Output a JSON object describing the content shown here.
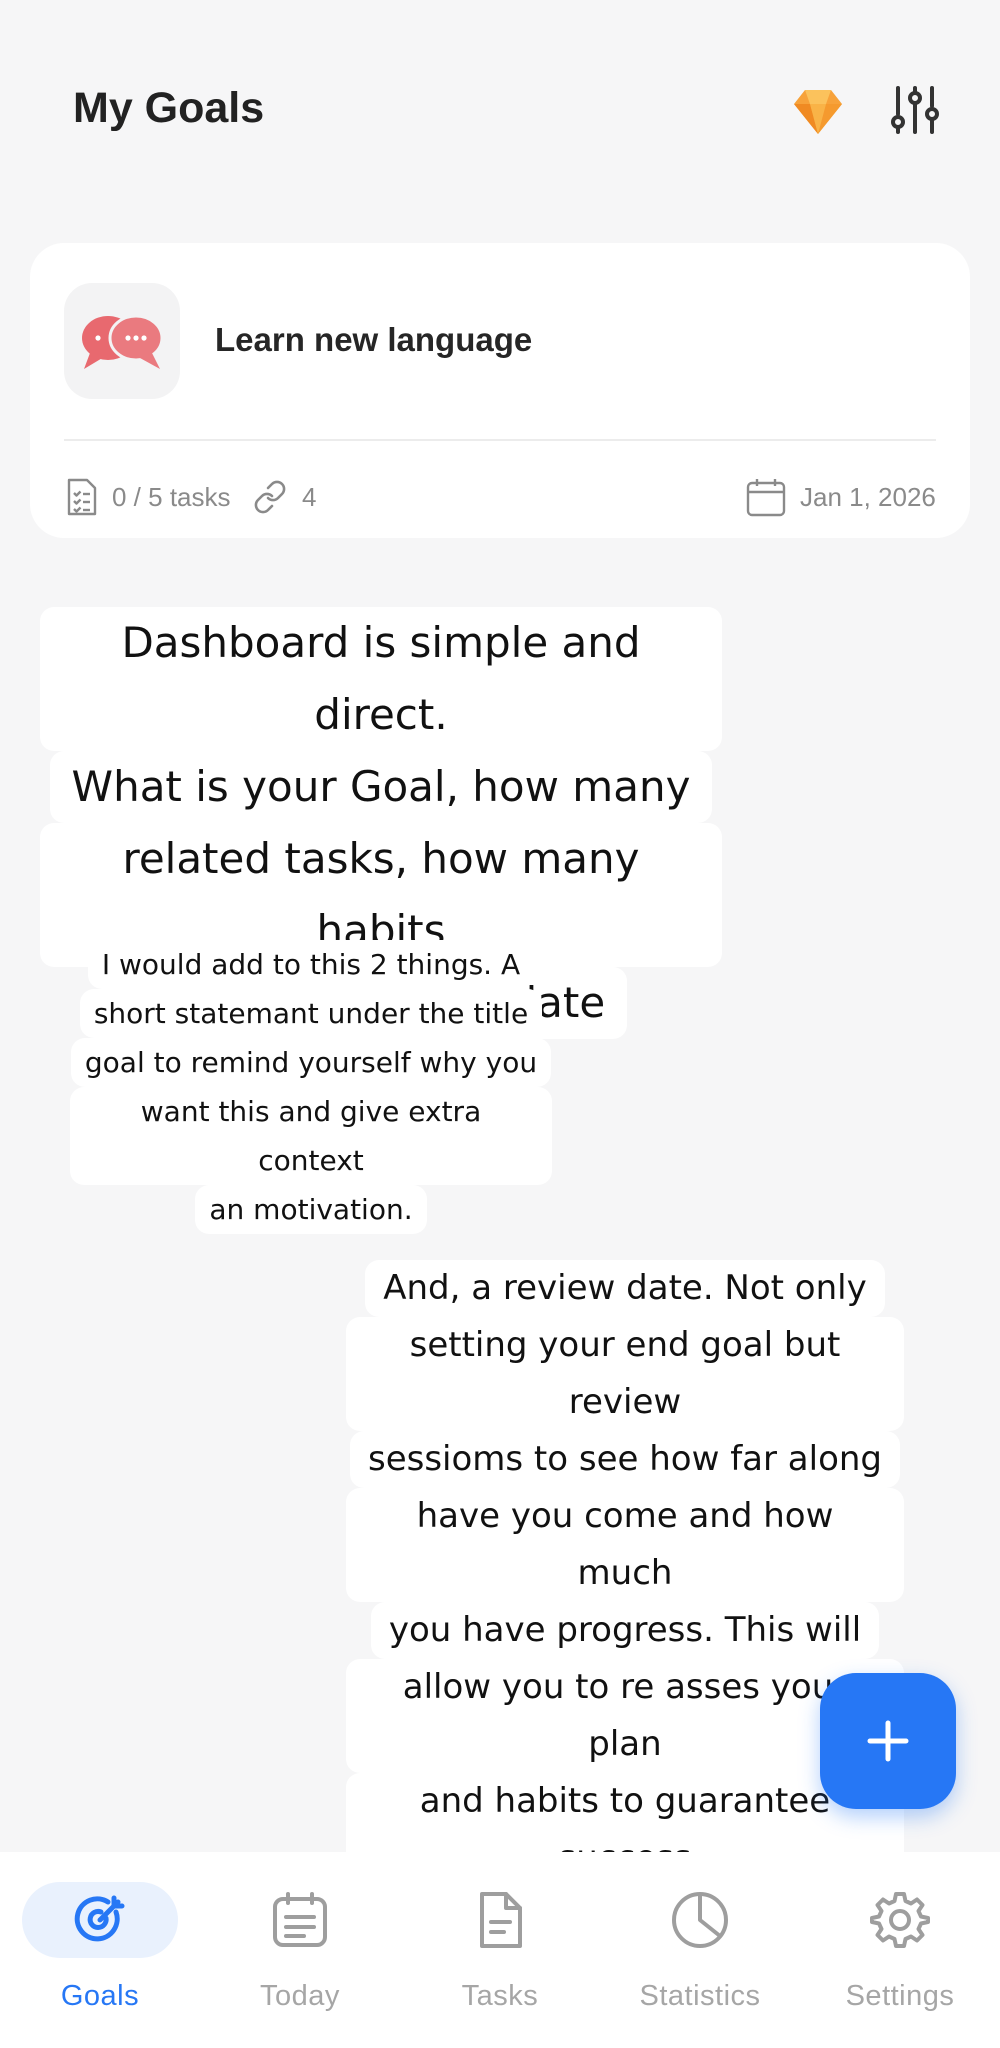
{
  "header": {
    "title": "My Goals",
    "icons": [
      "diamond-icon",
      "sliders-icon"
    ]
  },
  "goal_card": {
    "title": "Learn new language",
    "icon": "chat-bubbles-icon",
    "tasks_text": "0 / 5 tasks",
    "habits_count": "4",
    "date": "Jan 1, 2026",
    "accent_color": "#e8696f"
  },
  "annotations": {
    "note1": [
      "Dashboard is simple and direct.",
      "What is your Goal, how many",
      "related tasks, how many habits",
      "and an end goal date"
    ],
    "note2": [
      "I would add to this 2 things. A",
      "short statemant under the title",
      "goal to remind yourself why you",
      "want this and give extra context",
      "an motivation."
    ],
    "note3": [
      "And, a review date. Not only",
      "setting your end goal but review",
      "sessioms to see how far along",
      "have you come and how much",
      "you have progress. This will",
      "allow you to re asses your plan",
      "and habits to guarantee success"
    ]
  },
  "fab": {
    "icon": "plus-icon",
    "color": "#2677f5"
  },
  "bottom_nav": {
    "active": "Goals",
    "items": [
      {
        "label": "Goals",
        "icon": "target-icon"
      },
      {
        "label": "Today",
        "icon": "calendar-icon"
      },
      {
        "label": "Tasks",
        "icon": "document-icon"
      },
      {
        "label": "Statistics",
        "icon": "pie-chart-icon"
      },
      {
        "label": "Settings",
        "icon": "gear-icon"
      }
    ]
  }
}
